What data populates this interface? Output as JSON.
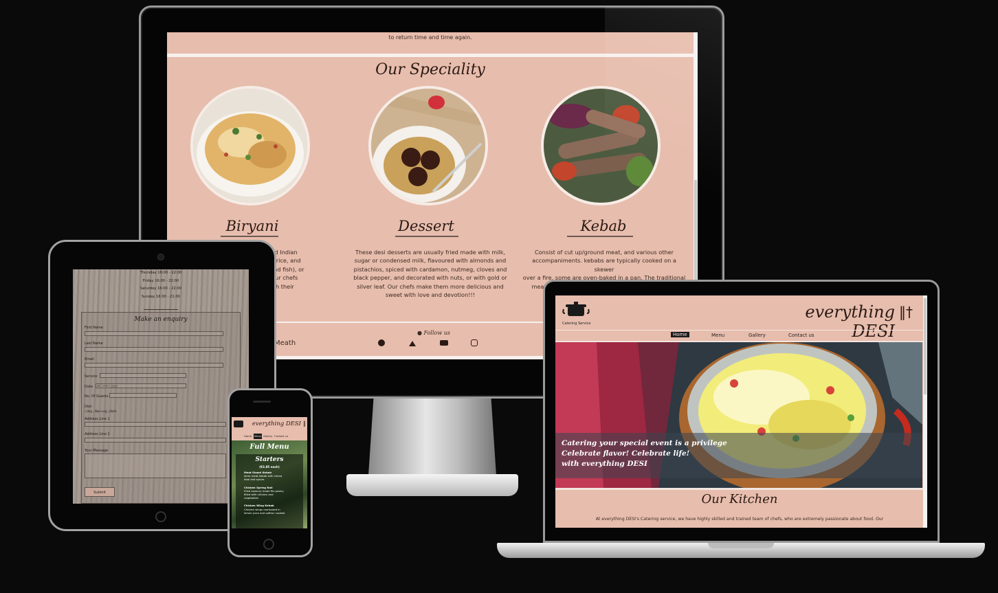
{
  "monitor": {
    "intro_text": "to return time and time again.",
    "section_title": "Our Speciality",
    "dishes": [
      {
        "title": "Biryani",
        "text": "tani and Indian\nspices, rice, and\nawn, and fish), or\ntoes. Our chefs\nntic with their"
      },
      {
        "title": "Dessert",
        "text": "These desi desserts are usually fried made with milk,\nsugar or condensed milk, flavoured with almonds and\npistachios, spiced with cardamon, nutmeg, cloves and\nblack pepper, and decorated with nuts, or with gold or\nsilver leaf. Our chefs make them more delicious and\nsweet with love and devotion!!!"
      },
      {
        "title": "Kebab",
        "text": "Consist of cut up/ground meat, and various other\naccompaniments. kebabs are typically cooked on a skewer\nover a fire, some are oven-baked in a pan. The traditional\nmeat for kebabs is most often lamb meat, beef and\nchicke"
      }
    ],
    "footer_location": "Meath",
    "follow_us": "Follow us",
    "social_icons": [
      "facebook-icon",
      "twitter-icon",
      "youtube-icon",
      "instagram-icon"
    ]
  },
  "tablet": {
    "hours": [
      "Thursday 16:00 - 22:00",
      "Friday 16:00 - 22:00",
      "Saturday 16:00 - 22:00",
      "Sunday 16:00 - 21:00"
    ],
    "form_title": "Make an enquiry",
    "fields": {
      "first_name": "First Name",
      "last_name": "Last Name",
      "email": "Email",
      "service": "Service",
      "date": "Date",
      "guests": "No. Of Guests",
      "diet": "Diet",
      "address1": "Address Line 1",
      "address2": "Address Line 2",
      "message": "Your Message"
    },
    "date_placeholder": "dd / mm / yyyy",
    "diet_options": [
      "Veg",
      "Non-veg",
      "Both"
    ],
    "submit_label": "Submit"
  },
  "phone": {
    "brand": "everything DESI",
    "nav": [
      "Home",
      "Menu",
      "Gallery",
      "Contact us"
    ],
    "menu_title": "Full Menu",
    "category": "Starters",
    "price": "(€3.85 each)",
    "items": [
      {
        "name": "Meat Shami Kebab",
        "desc": "lamb meat kebab with chana\ndaal and spices"
      },
      {
        "name": "Chicken Spring Roll",
        "desc": "Fried savoury made filo pastry\nfilled with chicken and\nvegetables"
      },
      {
        "name": "Chicken Wing Kebab",
        "desc": "Chicken wings marinated in\nlemon juice and saffron cooked"
      }
    ]
  },
  "laptop": {
    "logo_caption": "Catering Service",
    "brand": "everything DESI",
    "nav": [
      "Home",
      "Menu",
      "Gallery",
      "Contact us"
    ],
    "active_nav": "Home",
    "hero_lines": [
      "Catering your special event is a privilege",
      "Celebrate flavor! Celebrate life!",
      "with everything DESI"
    ],
    "section_title": "Our Kitchen",
    "section_text": "At everything DESI's Catering service, we have highly skilled and trained team of chefs, who are extremely passionate about food. Our"
  },
  "colors": {
    "background": "#0a0a0a",
    "site_pink": "#e7bdad",
    "text_dark": "#2b1a14"
  }
}
